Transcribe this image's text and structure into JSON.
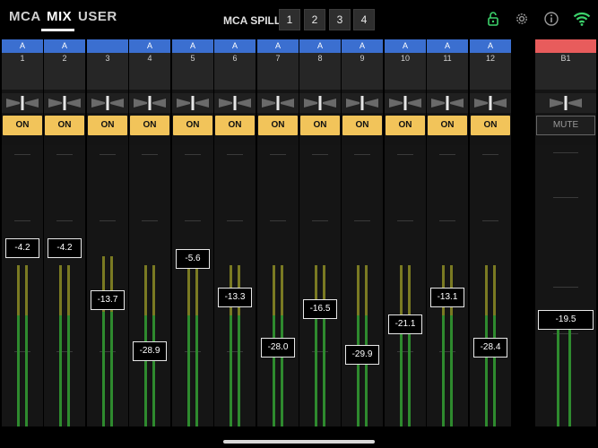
{
  "nav": {
    "tabs": [
      "MCA",
      "MIX",
      "USER"
    ],
    "active_tab": "MIX",
    "mca_spill_label": "MCA SPILL",
    "spill_buttons": [
      "1",
      "2",
      "3",
      "4"
    ]
  },
  "icons": {
    "lock": "lock-open-icon",
    "settings": "gear-icon",
    "info": "info-icon",
    "wifi": "wifi-icon"
  },
  "colors": {
    "assign_tag": "#3b6fd0",
    "bus_tag": "#e85c5c",
    "on_button": "#f2c45a",
    "meter_green": "#2e8a2e",
    "meter_yellow": "#7a7a22",
    "wifi": "#3cd36b",
    "lock": "#3cd36b"
  },
  "channels": [
    {
      "tag": "A",
      "number": "1",
      "on_label": "ON",
      "fader_db": "-4.2"
    },
    {
      "tag": "A",
      "number": "2",
      "on_label": "ON",
      "fader_db": "-4.2"
    },
    {
      "tag": "",
      "number": "3",
      "on_label": "ON",
      "fader_db": "-13.7"
    },
    {
      "tag": "A",
      "number": "4",
      "on_label": "ON",
      "fader_db": "-28.9"
    },
    {
      "tag": "A",
      "number": "5",
      "on_label": "ON",
      "fader_db": "-5.6"
    },
    {
      "tag": "A",
      "number": "6",
      "on_label": "ON",
      "fader_db": "-13.3"
    },
    {
      "tag": "A",
      "number": "7",
      "on_label": "ON",
      "fader_db": "-28.0"
    },
    {
      "tag": "A",
      "number": "8",
      "on_label": "ON",
      "fader_db": "-16.5"
    },
    {
      "tag": "A",
      "number": "9",
      "on_label": "ON",
      "fader_db": "-29.9"
    },
    {
      "tag": "A",
      "number": "10",
      "on_label": "ON",
      "fader_db": "-21.1"
    },
    {
      "tag": "A",
      "number": "11",
      "on_label": "ON",
      "fader_db": "-13.1"
    },
    {
      "tag": "A",
      "number": "12",
      "on_label": "ON",
      "fader_db": "-28.4"
    }
  ],
  "bus": {
    "tag": "",
    "number": "B1",
    "mute_label": "MUTE",
    "fader_db": "-19.5"
  }
}
